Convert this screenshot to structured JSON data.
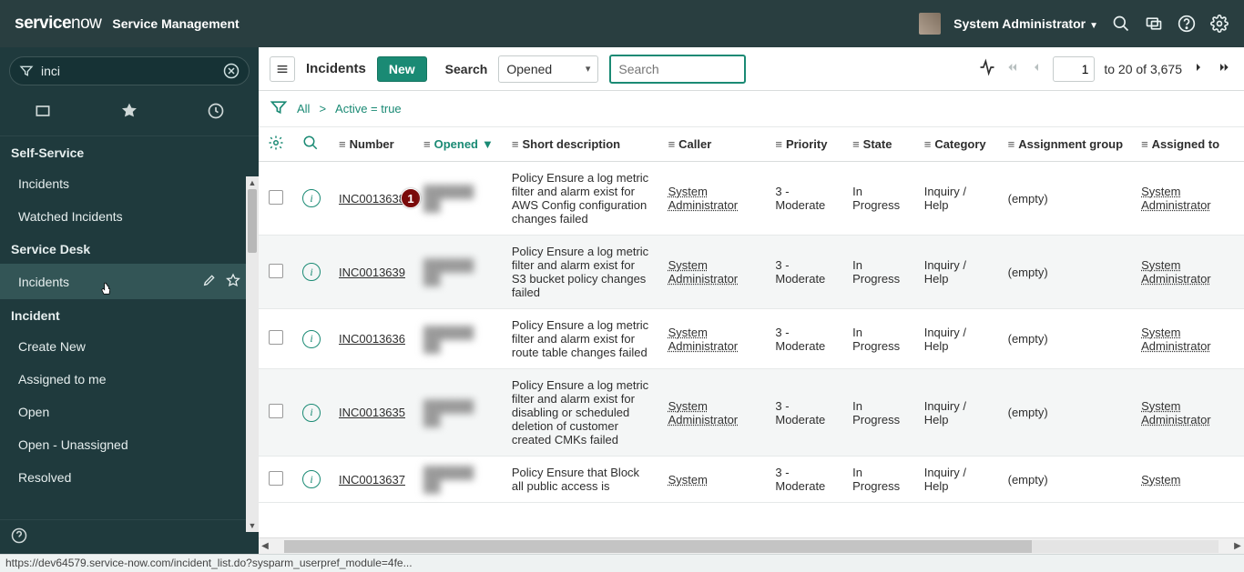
{
  "header": {
    "logo_main": "service",
    "logo_now": "now",
    "subtitle": "Service Management",
    "user_name": "System Administrator"
  },
  "sidebar": {
    "filter_value": "inci",
    "sections": [
      {
        "title": "Self-Service",
        "items": [
          {
            "label": "Incidents"
          },
          {
            "label": "Watched Incidents"
          }
        ]
      },
      {
        "title": "Service Desk",
        "items": [
          {
            "label": "Incidents",
            "hover": true
          }
        ]
      },
      {
        "title": "Incident",
        "items": [
          {
            "label": "Create New"
          },
          {
            "label": "Assigned to me"
          },
          {
            "label": "Open"
          },
          {
            "label": "Open - Unassigned"
          },
          {
            "label": "Resolved"
          }
        ]
      }
    ]
  },
  "toolbar": {
    "title": "Incidents",
    "new_label": "New",
    "search_label": "Search",
    "search_field": "Opened",
    "search_placeholder": "Search",
    "page_current": "1",
    "page_text": "to 20 of 3,675"
  },
  "breadcrumb": {
    "all": "All",
    "filter": "Active = true"
  },
  "columns": {
    "number": "Number",
    "opened": "Opened",
    "short_description": "Short description",
    "caller": "Caller",
    "priority": "Priority",
    "state": "State",
    "category": "Category",
    "assignment_group": "Assignment group",
    "assigned_to": "Assigned to"
  },
  "rows": [
    {
      "number": "INC0013638",
      "opened_blur": "██████ ██",
      "short_description": "Policy Ensure a log metric filter and alarm exist for AWS Config configuration changes failed",
      "caller": "System Administrator",
      "priority": "3 - Moderate",
      "state": "In Progress",
      "category": "Inquiry / Help",
      "assignment_group": "(empty)",
      "assigned_to": "System Administrator",
      "badge": "1"
    },
    {
      "number": "INC0013639",
      "opened_blur": "██████ ██",
      "short_description": "Policy Ensure a log metric filter and alarm exist for S3 bucket policy changes failed",
      "caller": "System Administrator",
      "priority": "3 - Moderate",
      "state": "In Progress",
      "category": "Inquiry / Help",
      "assignment_group": "(empty)",
      "assigned_to": "System Administrator"
    },
    {
      "number": "INC0013636",
      "opened_blur": "██████ ██",
      "short_description": "Policy Ensure a log metric filter and alarm exist for route table changes failed",
      "caller": "System Administrator",
      "priority": "3 - Moderate",
      "state": "In Progress",
      "category": "Inquiry / Help",
      "assignment_group": "(empty)",
      "assigned_to": "System Administrator"
    },
    {
      "number": "INC0013635",
      "opened_blur": "██████ ██",
      "short_description": "Policy Ensure a log metric filter and alarm exist for disabling or scheduled deletion of customer created CMKs failed",
      "caller": "System Administrator",
      "priority": "3 - Moderate",
      "state": "In Progress",
      "category": "Inquiry / Help",
      "assignment_group": "(empty)",
      "assigned_to": "System Administrator"
    },
    {
      "number": "INC0013637",
      "opened_blur": "██████ ██",
      "short_description": "Policy Ensure that Block all public access is",
      "caller": "System",
      "priority": "3 - Moderate",
      "state": "In Progress",
      "category": "Inquiry / Help",
      "assignment_group": "(empty)",
      "assigned_to": "System"
    }
  ],
  "statusbar": {
    "url": "https://dev64579.service-now.com/incident_list.do?sysparm_userpref_module=4fe..."
  }
}
